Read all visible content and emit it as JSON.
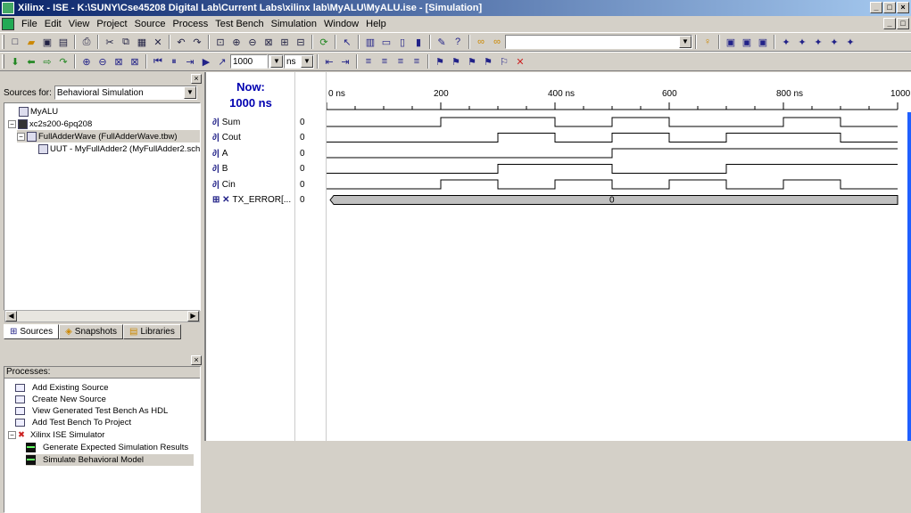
{
  "window": {
    "title": "Xilinx - ISE - K:\\SUNY\\Cse45208 Digital Lab\\Current Labs\\xilinx lab\\MyALU\\MyALU.ise - [Simulation]",
    "min": "_",
    "max": "□",
    "close": "×"
  },
  "menu": [
    "File",
    "Edit",
    "View",
    "Project",
    "Source",
    "Process",
    "Test Bench",
    "Simulation",
    "Window",
    "Help"
  ],
  "toolbar2": {
    "sim_time": "1000",
    "time_unit": "ns"
  },
  "sources": {
    "label": "Sources for:",
    "selected": "Behavioral Simulation",
    "tree": [
      {
        "label": "MyALU"
      },
      {
        "label": "xc2s200-6pq208"
      },
      {
        "label": "FullAdderWave (FullAdderWave.tbw)"
      },
      {
        "label": "UUT - MyFullAdder2 (MyFullAdder2.sch"
      }
    ],
    "tabs": [
      "Sources",
      "Snapshots",
      "Libraries"
    ]
  },
  "processes": {
    "header": "Processes:",
    "items": [
      "Add Existing Source",
      "Create New Source",
      "View Generated Test Bench As HDL",
      "Add Test Bench To Project",
      "Xilinx ISE Simulator",
      "Generate Expected Simulation Results",
      "Simulate Behavioral Model"
    ]
  },
  "waveform": {
    "now_label": "Now:",
    "now_time": "1000 ns",
    "ticks": [
      "0 ns",
      "200",
      "400 ns",
      "600",
      "800 ns",
      "1000"
    ],
    "time_range": [
      0,
      1000
    ],
    "signals": [
      {
        "name": "Sum",
        "value": "0",
        "transitions": [
          [
            0,
            0
          ],
          [
            200,
            1
          ],
          [
            400,
            0
          ],
          [
            500,
            1
          ],
          [
            600,
            0
          ],
          [
            800,
            1
          ],
          [
            900,
            0
          ]
        ]
      },
      {
        "name": "Cout",
        "value": "0",
        "transitions": [
          [
            0,
            0
          ],
          [
            300,
            1
          ],
          [
            400,
            0
          ],
          [
            500,
            1
          ],
          [
            600,
            0
          ],
          [
            700,
            1
          ],
          [
            900,
            0
          ]
        ]
      },
      {
        "name": "A",
        "value": "0",
        "transitions": [
          [
            0,
            0
          ],
          [
            500,
            1
          ],
          [
            1000,
            1
          ]
        ]
      },
      {
        "name": "B",
        "value": "0",
        "transitions": [
          [
            0,
            0
          ],
          [
            300,
            1
          ],
          [
            500,
            0
          ],
          [
            700,
            1
          ]
        ]
      },
      {
        "name": "Cin",
        "value": "0",
        "transitions": [
          [
            0,
            0
          ],
          [
            200,
            1
          ],
          [
            300,
            0
          ],
          [
            400,
            1
          ],
          [
            500,
            0
          ],
          [
            600,
            1
          ],
          [
            700,
            0
          ],
          [
            800,
            1
          ],
          [
            900,
            0
          ]
        ]
      },
      {
        "name": "TX_ERROR[...",
        "value": "0",
        "bus_value": "0"
      }
    ]
  }
}
